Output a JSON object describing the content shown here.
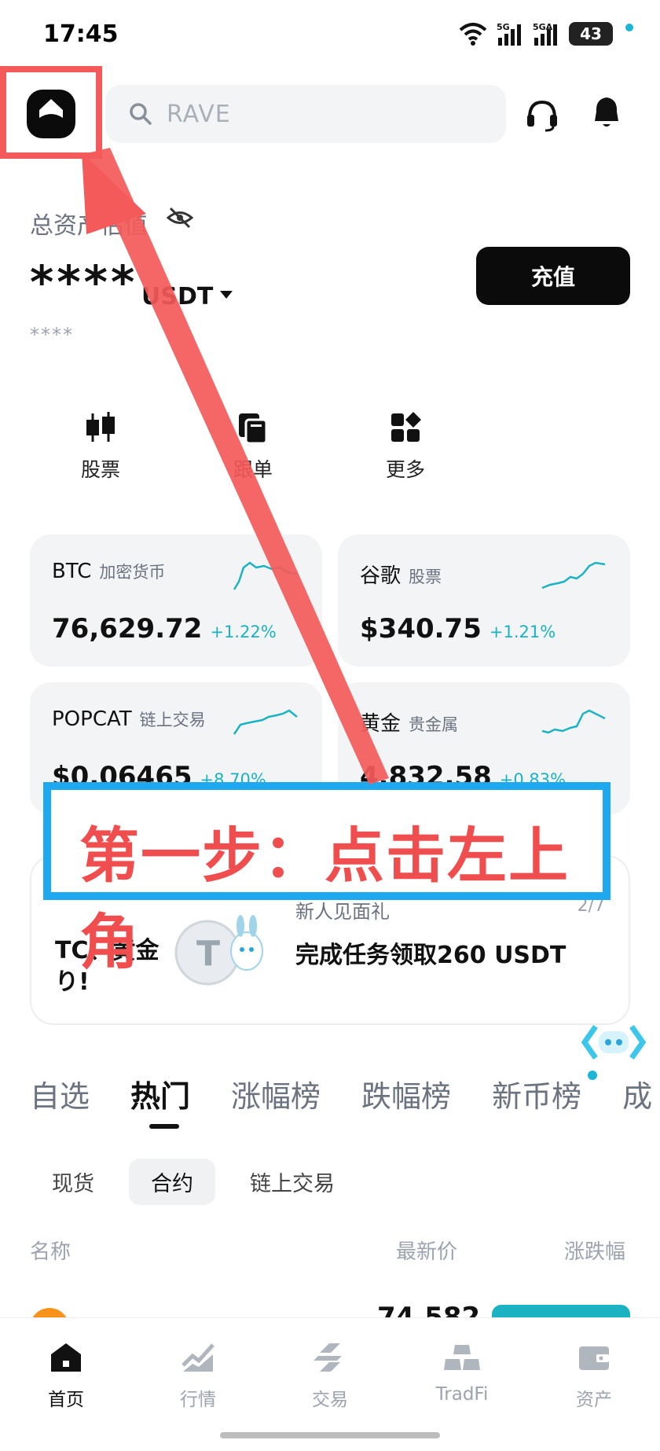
{
  "status_bar": {
    "time": "17:45",
    "battery": "43"
  },
  "search": {
    "placeholder": "RAVE"
  },
  "assets": {
    "label": "总资产估值",
    "value": "****",
    "unit": "USDT",
    "sub_value": "****",
    "deposit_label": "充值"
  },
  "quick_actions": [
    {
      "label": "股票",
      "icon": "candlestick-icon"
    },
    {
      "label": "跟单",
      "icon": "copy-trade-icon"
    },
    {
      "label": "更多",
      "icon": "grid-more-icon"
    }
  ],
  "market_cards": [
    {
      "name": "BTC",
      "tag": "加密货币",
      "price": "76,629.72",
      "change": "+1.22%"
    },
    {
      "name": "谷歌",
      "tag": "股票",
      "price": "$340.75",
      "change": "+1.21%"
    },
    {
      "name": "POPCAT",
      "tag": "链上交易",
      "price": "$0.06465",
      "change": "+8.70%"
    },
    {
      "name": "黄金",
      "tag": "贵金属",
      "price": "4,832.58",
      "change": "+0.83%"
    }
  ],
  "promo": {
    "left_line1": "TC、黄金",
    "left_line2": "り!",
    "title": "新人见面礼",
    "main": "完成任务领取260 USDT",
    "page": "2/7"
  },
  "tutorial": {
    "text": "第一步：点击左上角"
  },
  "tabs": [
    "自选",
    "热门",
    "涨幅榜",
    "跌幅榜",
    "新币榜",
    "成"
  ],
  "subtabs": [
    "现货",
    "合约",
    "链上交易"
  ],
  "table_headers": {
    "name": "名称",
    "price": "最新价",
    "change": "涨跌幅"
  },
  "peek_row": {
    "price": "74,582"
  },
  "bottom_nav": [
    {
      "label": "首页",
      "icon": "home-icon"
    },
    {
      "label": "行情",
      "icon": "market-chart-icon"
    },
    {
      "label": "交易",
      "icon": "trade-swap-icon"
    },
    {
      "label": "TradFi",
      "icon": "gold-bars-icon"
    },
    {
      "label": "资产",
      "icon": "wallet-icon"
    }
  ],
  "colors": {
    "accent": "#1bb3c4",
    "highlight_red": "#f45a5a",
    "highlight_blue": "#1ea8f0"
  }
}
